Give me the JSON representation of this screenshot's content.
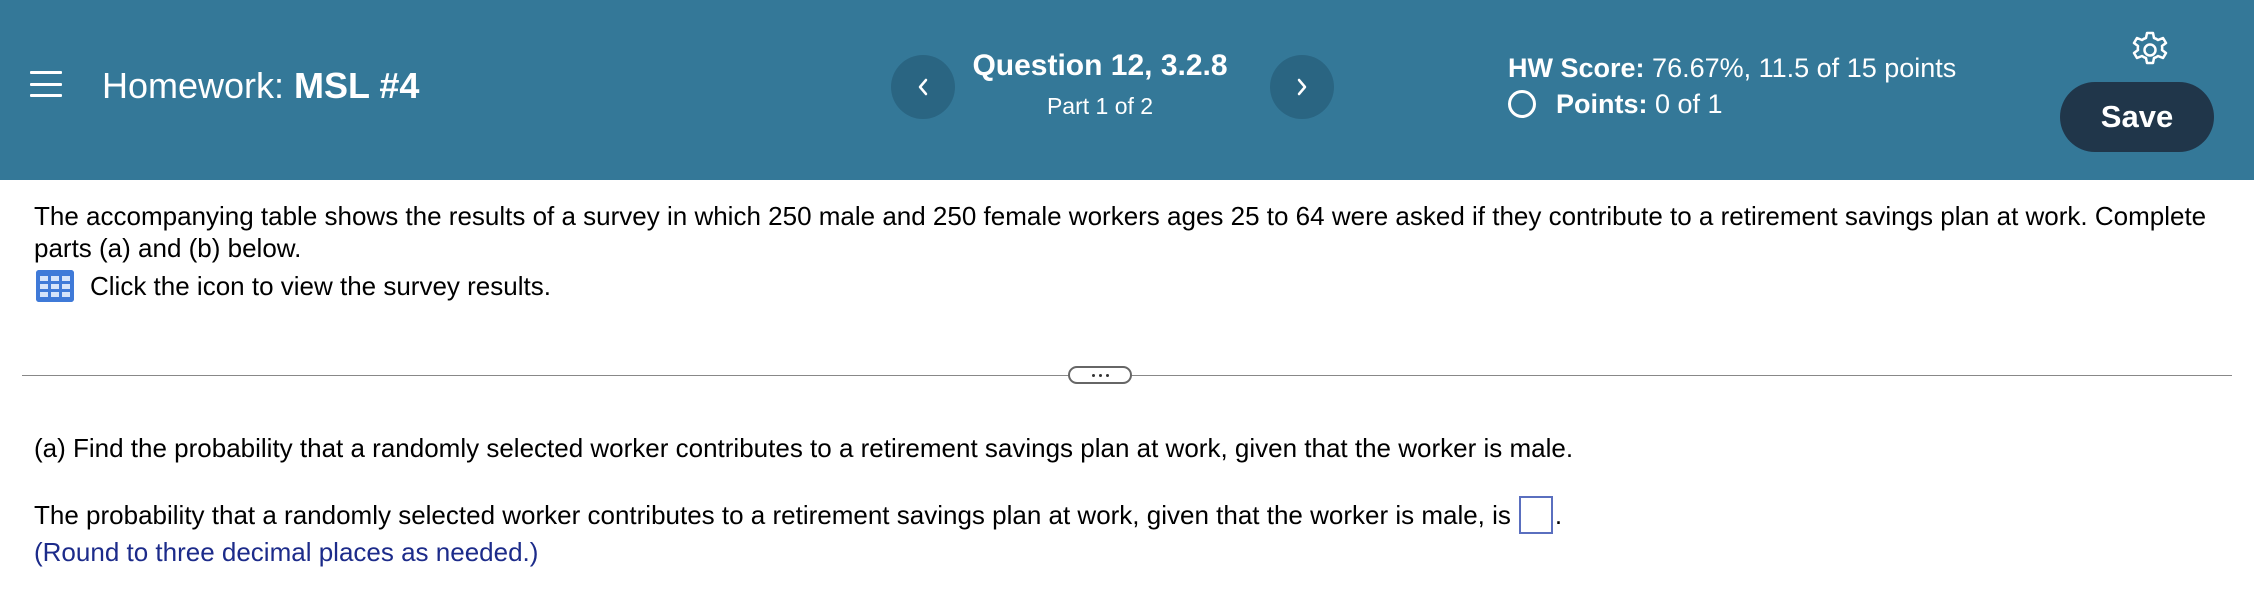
{
  "header": {
    "homework_label": "Homework:",
    "homework_name": "MSL #4",
    "question_title": "Question 12, 3.2.8",
    "question_part": "Part 1 of 2",
    "prev_icon": "chevron-left-icon",
    "next_icon": "chevron-right-icon",
    "hw_score_label": "HW Score:",
    "hw_score_value": "76.67%, 11.5 of 15 points",
    "points_label": "Points:",
    "points_value": "0 of 1",
    "save_label": "Save",
    "settings_icon": "gear-icon",
    "menu_icon": "hamburger-menu-icon",
    "colors": {
      "bar": "#347898",
      "nav_button": "#2a6582",
      "save_button": "#20364a"
    }
  },
  "question": {
    "intro": "The accompanying table shows the results of a survey in which 250 male and 250 female workers ages 25 to 64 were asked if they contribute to a retirement savings plan at work. Complete parts (a) and (b) below.",
    "table_link_text": "Click the icon to view the survey results.",
    "table_icon": "table-grid-icon",
    "part_a_prompt": "(a) Find the probability that a randomly selected worker contributes to a retirement savings plan at work, given that the worker is male.",
    "answer_prefix": "The probability that a randomly selected worker contributes to a retirement savings plan at work, given that the worker is male, is",
    "answer_suffix": ".",
    "answer_value": "",
    "hint": "(Round to three decimal places as needed.)",
    "hint_color": "#1c2b8a"
  }
}
